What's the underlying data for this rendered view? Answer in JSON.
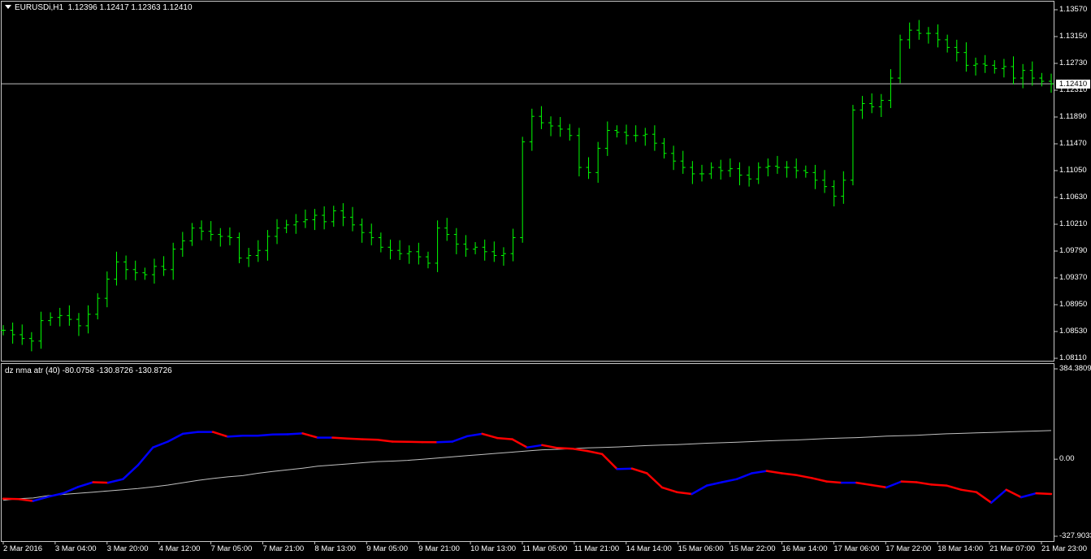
{
  "chart_data": [
    {
      "type": "line",
      "title": "EURUSDi,H1",
      "quote": "1.12396 1.12417 1.12363 1.12410",
      "current_price": "1.12410",
      "current_value": 1.1241,
      "ylim": [
        1.0811,
        1.1357
      ],
      "y_ticks": [
        "1.13570",
        "1.13150",
        "1.12730",
        "1.12310",
        "1.11890",
        "1.11470",
        "1.11050",
        "1.10630",
        "1.10210",
        "1.09790",
        "1.09370",
        "1.08950",
        "1.08530",
        "1.08110"
      ],
      "candle_color": "#00ff00",
      "series": [
        {
          "values": [
            1.0855,
            1.0848,
            1.0842,
            1.0838,
            1.087,
            1.0875,
            1.0878,
            1.0872,
            1.0862,
            1.088,
            1.0905,
            1.0935,
            1.0962,
            1.095,
            1.0945,
            1.0942,
            1.0955,
            1.095,
            1.0982,
            1.0995,
            1.1015,
            1.101,
            1.1005,
            1.1002,
            1.1,
            1.0968,
            1.0972,
            1.098,
            1.1002,
            1.1015,
            1.102,
            1.1025,
            1.1028,
            1.1035,
            1.1025,
            1.1042,
            1.1032,
            1.102,
            1.1008,
            1.1,
            1.0985,
            1.098,
            1.0975,
            1.0978,
            1.097,
            1.096,
            1.1015,
            1.1005,
            1.099,
            1.0982,
            1.0985,
            1.0978,
            1.0972,
            1.0975,
            1.1,
            1.115,
            1.119,
            1.118,
            1.1175,
            1.117,
            1.116,
            1.111,
            1.1102,
            1.114,
            1.1168,
            1.1165,
            1.116,
            1.116,
            1.1162,
            1.1148,
            1.1132,
            1.112,
            1.111,
            1.11,
            1.11,
            1.111,
            1.1105,
            1.1108,
            1.1098,
            1.1092,
            1.111,
            1.1112,
            1.111,
            1.111,
            1.1105,
            1.1102,
            1.109,
            1.108,
            1.1065,
            1.109,
            1.12,
            1.121,
            1.1205,
            1.1215,
            1.125,
            1.131,
            1.1325,
            1.132,
            1.132,
            1.131,
            1.1298,
            1.129,
            1.127,
            1.1272,
            1.127,
            1.1265,
            1.1268,
            1.125,
            1.1262,
            1.125,
            1.1245,
            1.1241
          ]
        }
      ]
    },
    {
      "type": "line",
      "title": "dz nma atr (40) -80.0758 -130.8726 -130.8726",
      "ylim": [
        -327.9033,
        384.3809
      ],
      "y_ticks": [
        "384.3809",
        "0.00",
        "-327.9033"
      ],
      "x_ticks": [
        "2 Mar 2016",
        "3 Mar 04:00",
        "3 Mar 20:00",
        "4 Mar 12:00",
        "7 Mar 05:00",
        "7 Mar 21:00",
        "8 Mar 13:00",
        "9 Mar 05:00",
        "9 Mar 21:00",
        "10 Mar 13:00",
        "11 Mar 05:00",
        "11 Mar 21:00",
        "14 Mar 14:00",
        "15 Mar 06:00",
        "15 Mar 22:00",
        "16 Mar 14:00",
        "17 Mar 06:00",
        "17 Mar 22:00",
        "18 Mar 14:00",
        "21 Mar 07:00",
        "21 Mar 23:00"
      ],
      "colors": {
        "up": "#0000ff",
        "down": "#ff0000",
        "signal": "#c0c0c0"
      },
      "series": [
        {
          "values": [
            -168,
            -170,
            -178,
            -160,
            -145,
            -118,
            -98,
            -100,
            -85,
            -25,
            50,
            75,
            108,
            116,
            116,
            96,
            100,
            100,
            105,
            106,
            110,
            92,
            92,
            88,
            85,
            83,
            75,
            74,
            73,
            72,
            75,
            98,
            108,
            90,
            85,
            50,
            60,
            48,
            45,
            35,
            22,
            -42,
            -40,
            -60,
            -120,
            -140,
            -148,
            -112,
            -98,
            -85,
            -60,
            -50,
            -60,
            -68,
            -80,
            -95,
            -100,
            -100,
            -110,
            -120,
            -95,
            -98,
            -108,
            -112,
            -130,
            -140,
            -185,
            -130,
            -162,
            -145,
            -148
          ]
        },
        {
          "values": [
            -175,
            -168,
            -165,
            -155,
            -150,
            -145,
            -140,
            -135,
            -130,
            -125,
            -118,
            -110,
            -100,
            -90,
            -82,
            -75,
            -70,
            -60,
            -52,
            -45,
            -38,
            -30,
            -25,
            -20,
            -15,
            -10,
            -8,
            -5,
            0,
            5,
            10,
            15,
            20,
            25,
            30,
            35,
            40,
            42,
            45,
            48,
            50,
            52,
            55,
            58,
            60,
            62,
            65,
            68,
            70,
            72,
            75,
            78,
            80,
            82,
            85,
            88,
            90,
            92,
            95,
            98,
            100,
            102,
            105,
            108,
            110,
            112,
            114,
            116,
            118,
            120,
            122
          ]
        }
      ]
    }
  ]
}
